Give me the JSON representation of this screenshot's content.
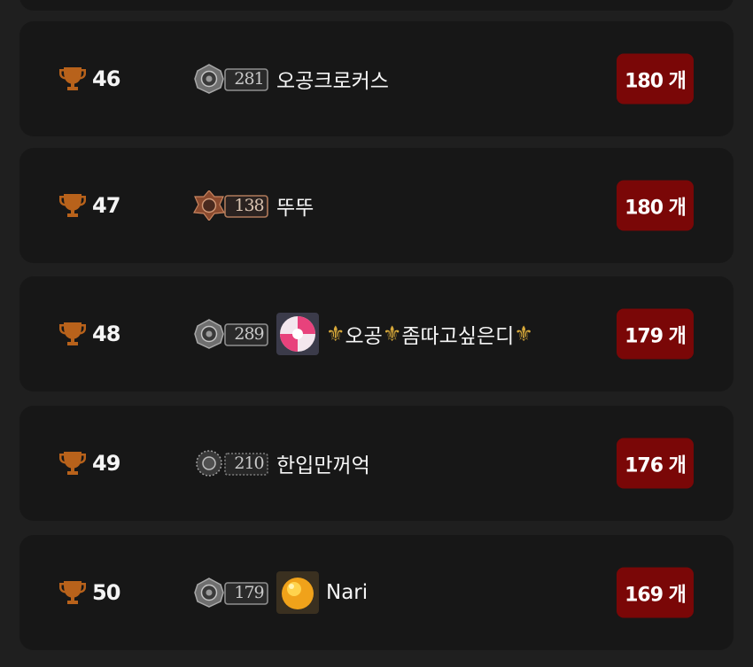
{
  "colors": {
    "page_background": "#1f1f1f",
    "card_background": "#171717",
    "count_badge": "#7a0707",
    "trophy": "#b8621b",
    "fleur": "#d8a93a"
  },
  "icons": {
    "rank": "trophy-icon",
    "level_badge": "level-emblem-icon",
    "decoration": "fleur-de-lis-icon"
  },
  "rankings": [
    {
      "rank": "46",
      "level": "281",
      "badge_style": "silver",
      "has_avatar": false,
      "nickname": "오공크로커스",
      "count": "180 개"
    },
    {
      "rank": "47",
      "level": "138",
      "badge_style": "bronze",
      "has_avatar": false,
      "nickname": "뚜뚜",
      "count": "180 개"
    },
    {
      "rank": "48",
      "level": "289",
      "badge_style": "silver",
      "has_avatar": true,
      "avatar_style": "candy",
      "nickname_parts": [
        "오공",
        "좀따고싶은디"
      ],
      "count": "179 개"
    },
    {
      "rank": "49",
      "level": "210",
      "badge_style": "dotted",
      "has_avatar": false,
      "nickname": "한입만꺼억",
      "count": "176 개"
    },
    {
      "rank": "50",
      "level": "179",
      "badge_style": "silver",
      "has_avatar": true,
      "avatar_style": "orange",
      "nickname": "Nari",
      "count": "169 개"
    }
  ]
}
